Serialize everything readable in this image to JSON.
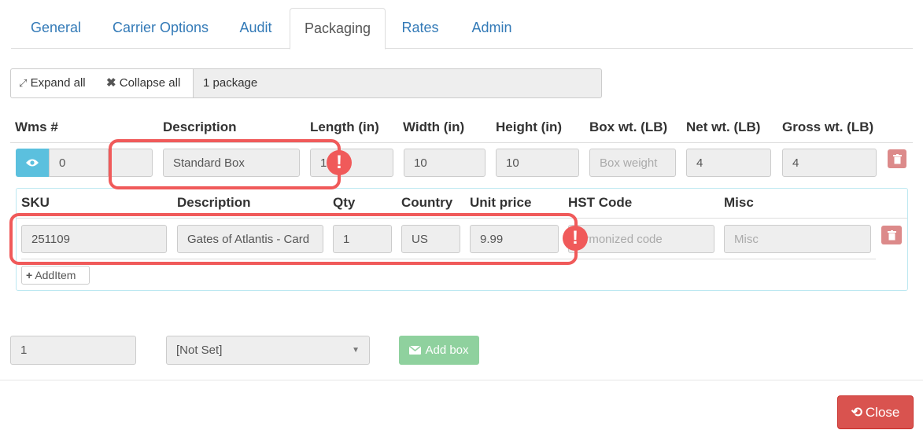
{
  "tabs": [
    {
      "label": "General"
    },
    {
      "label": "Carrier Options"
    },
    {
      "label": "Audit"
    },
    {
      "label": "Packaging"
    },
    {
      "label": "Rates"
    },
    {
      "label": "Admin"
    }
  ],
  "active_tab": "Packaging",
  "toolbar": {
    "expand_label": "Expand all",
    "collapse_label": "Collapse all",
    "package_count": "1 package"
  },
  "box_headers": {
    "wms": "Wms #",
    "description": "Description",
    "length": "Length (in)",
    "width": "Width (in)",
    "height": "Height (in)",
    "box_wt": "Box wt. (LB)",
    "net_wt": "Net wt. (LB)",
    "gross_wt": "Gross wt. (LB)"
  },
  "box_row": {
    "wms": "0",
    "extra": "",
    "description": "Standard Box",
    "length": "1",
    "width": "10",
    "height": "10",
    "box_weight_placeholder": "Box weight",
    "net_wt": "4",
    "gross_wt": "4"
  },
  "item_headers": {
    "sku": "SKU",
    "description": "Description",
    "qty": "Qty",
    "country": "Country",
    "unit_price": "Unit price",
    "hst": "HST Code",
    "misc": "Misc"
  },
  "item_row": {
    "sku": "251109",
    "description": "Gates of Atlantis - Card",
    "qty": "1",
    "country": "US",
    "unit_price": "9.99",
    "hst_placeholder": "armonized code",
    "misc_placeholder": "Misc"
  },
  "add_item_label": "AddItem",
  "footer": {
    "count": "1",
    "select_value": "[Not Set]",
    "add_box_label": "Add box",
    "close_label": "Close"
  },
  "colors": {
    "link": "#337ab7",
    "eye_button": "#5bc0de",
    "add_box": "#8fd19e",
    "close": "#d9534f",
    "highlight": "#f05a5a"
  }
}
